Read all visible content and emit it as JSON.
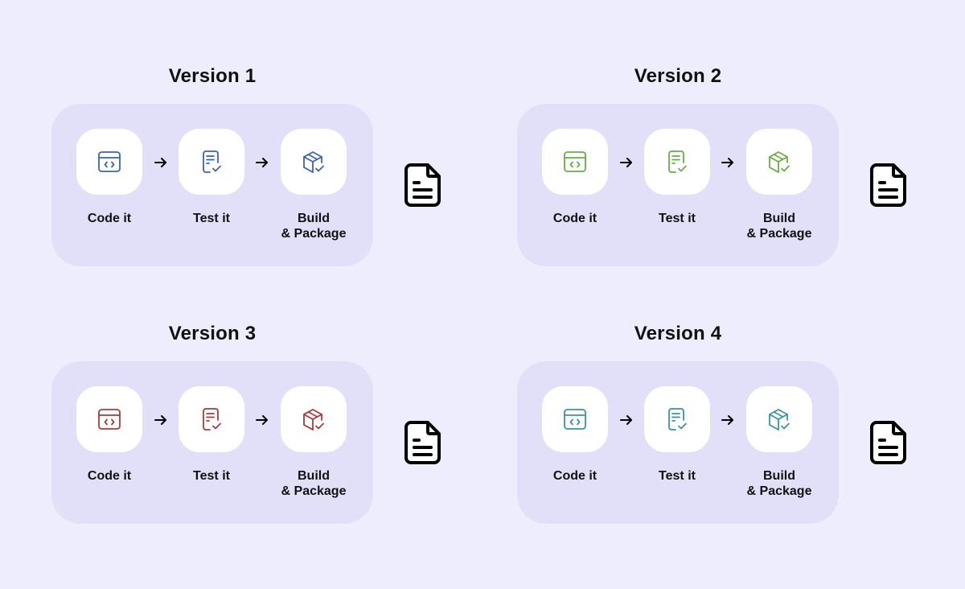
{
  "steps": {
    "code": "Code it",
    "test": "Test it",
    "build_line1": "Build",
    "build_line2": "& Package"
  },
  "icons": {
    "code": "code-window-icon",
    "test": "checklist-document-icon",
    "build": "package-check-icon",
    "arrow": "arrow-right-icon",
    "output": "document-icon"
  },
  "versions": [
    {
      "title": "Version 1",
      "color": "#3d64b0"
    },
    {
      "title": "Version 2",
      "color": "#6aac45"
    },
    {
      "title": "Version 3",
      "color": "#a83b3b"
    },
    {
      "title": "Version 4",
      "color": "#3c93a3"
    }
  ]
}
